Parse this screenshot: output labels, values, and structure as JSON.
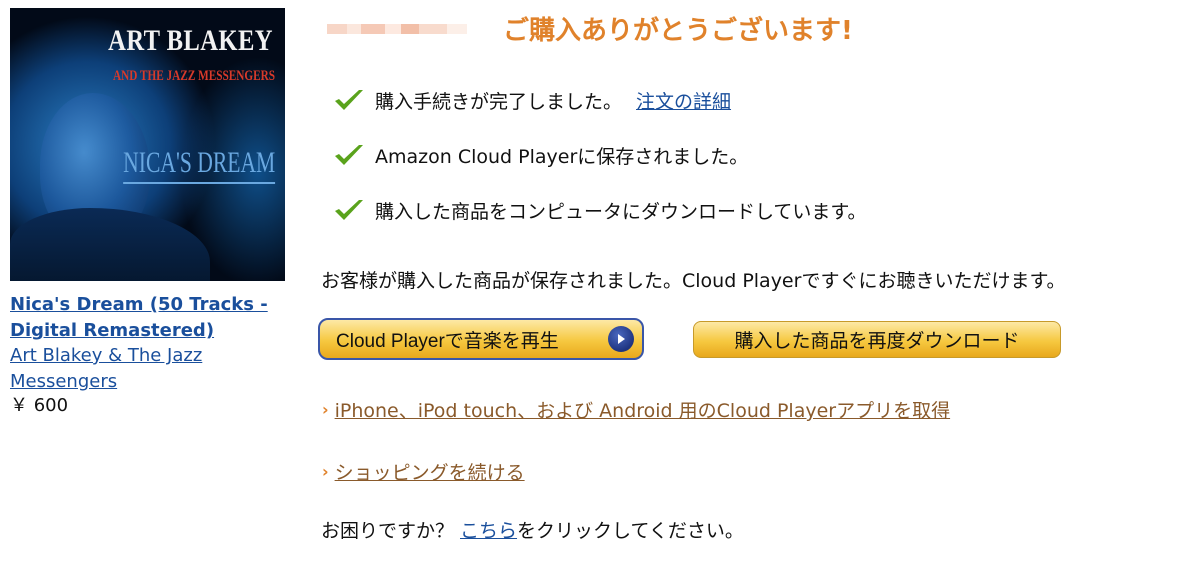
{
  "colors": {
    "heading": "#e0822b",
    "link_blue": "#1a4f9c",
    "link_brown": "#8a5a2b",
    "check_green": "#5aa31c",
    "button_gold": "#f6c840",
    "play_button_border": "#3a56a8"
  },
  "album": {
    "art": {
      "artist": "ART BLAKEY",
      "band": "AND THE JAZZ MESSENGERS",
      "album": "NICA'S DREAM"
    },
    "title": "Nica's Dream (50 Tracks - Digital Remastered)",
    "artist": "Art Blakey & The Jazz Messengers",
    "price": "￥ 600"
  },
  "header": {
    "heading": "ご購入ありがとうございます!"
  },
  "status": {
    "items": [
      {
        "icon": "check-icon",
        "text": "購入手続きが完了しました。",
        "link": "注文の詳細"
      },
      {
        "icon": "check-icon",
        "text": "Amazon Cloud Playerに保存されました。"
      },
      {
        "icon": "check-icon",
        "text": "購入した商品をコンピュータにダウンロードしています。"
      }
    ]
  },
  "main": {
    "saved_message": "お客様が購入した商品が保存されました。Cloud Playerですぐにお聴きいただけます。",
    "play_button_label": "Cloud Playerで音楽を再生",
    "download_button_label": "購入した商品を再度ダウンロード",
    "links": [
      {
        "icon": "arrow-right-icon",
        "label": "iPhone、iPod touch、および Android 用のCloud Playerアプリを取得"
      },
      {
        "icon": "arrow-right-icon",
        "label": "ショッピングを続ける"
      }
    ]
  },
  "help": {
    "prefix": "お困りですか？",
    "link": "こちら",
    "suffix": "をクリックしてください。"
  }
}
